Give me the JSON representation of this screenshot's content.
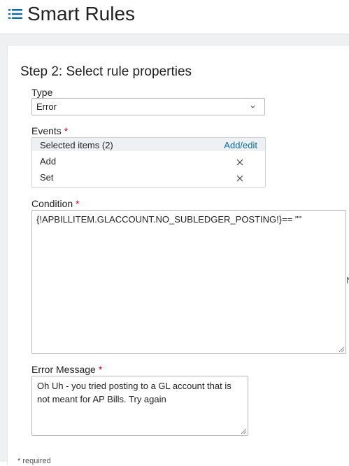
{
  "header": {
    "title": "Smart Rules",
    "icon": "list-icon"
  },
  "step": {
    "title": "Step 2: Select rule properties"
  },
  "type_field": {
    "label": "Type",
    "value": "Error"
  },
  "events": {
    "label": "Events",
    "required_mark": "*",
    "selected_label": "Selected items (2)",
    "add_edit": "Add/edit",
    "items": [
      "Add",
      "Set"
    ]
  },
  "condition": {
    "label": "Condition",
    "required_mark": "*",
    "value": "{!APBILLITEM.GLACCOUNT.NO_SUBLEDGER_POSTING!}== \"\""
  },
  "error_message": {
    "label": "Error Message",
    "required_mark": "*",
    "value": "Oh Uh - you tried posting to a GL account that is not meant for AP Bills. Try again"
  },
  "edge_glyph": "N",
  "footnote": "* required",
  "colors": {
    "accent": "#0a6aa8",
    "required": "#d0021b"
  }
}
